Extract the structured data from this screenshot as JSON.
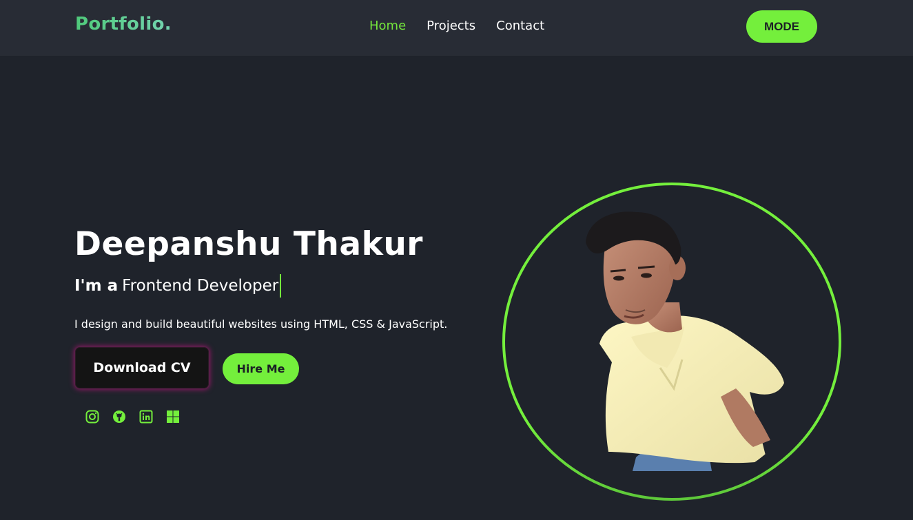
{
  "nav": {
    "logo": "Portfolio.",
    "links": [
      "Home",
      "Projects",
      "Contact"
    ],
    "active_link": "Home",
    "mode_label": "MODE"
  },
  "hero": {
    "name": "Deepanshu Thakur",
    "role_prefix": "I'm a",
    "role_typed": "Frontend Developer",
    "tagline": "I design and build beautiful websites using HTML, CSS & JavaScript.",
    "download_label": "Download CV",
    "hire_label": "Hire Me"
  },
  "socials": [
    "instagram-icon",
    "github-icon",
    "linkedin-icon",
    "windows-icon"
  ],
  "colors": {
    "accent": "#74ef3c",
    "background": "#1f232b",
    "navbar": "#282c35"
  }
}
